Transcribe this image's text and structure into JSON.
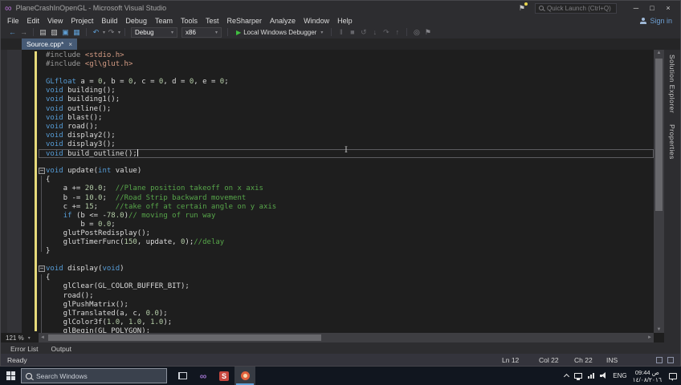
{
  "icons": {
    "dropdown": "▾",
    "play": "▶",
    "close": "×",
    "minimize": "─",
    "maximize": "□",
    "flag": "⚑",
    "infinity": "∞",
    "fold_minus": "−",
    "up": "▲",
    "down": "▼",
    "left": "◄",
    "right": "►"
  },
  "titlebar": {
    "title": "PlaneCrashInOpenGL - Microsoft Visual Studio",
    "quick_launch": "Quick Launch (Ctrl+Q)",
    "sign_in": "Sign in"
  },
  "menus": [
    "File",
    "Edit",
    "View",
    "Project",
    "Build",
    "Debug",
    "Team",
    "Tools",
    "Test",
    "ReSharper",
    "Analyze",
    "Window",
    "Help"
  ],
  "toolbar": {
    "items": [
      {
        "type": "icon",
        "name": "navigate-backward-icon",
        "glyph": "←",
        "color": "#5f9fd6"
      },
      {
        "type": "icon",
        "name": "navigate-forward-icon",
        "glyph": "→",
        "color": "#85858a"
      },
      {
        "type": "sep"
      },
      {
        "type": "icon",
        "name": "new-file-icon",
        "glyph": "▤",
        "color": "#c8c8c8"
      },
      {
        "type": "icon",
        "name": "open-file-icon",
        "glyph": "▨",
        "color": "#c8c8c8"
      },
      {
        "type": "icon",
        "name": "save-icon",
        "glyph": "▣",
        "color": "#5f9fd6"
      },
      {
        "type": "icon",
        "name": "save-all-icon",
        "glyph": "▦",
        "color": "#5f9fd6"
      },
      {
        "type": "sep"
      },
      {
        "type": "icon",
        "name": "undo-icon",
        "glyph": "↶",
        "color": "#5f9fd6",
        "dropdown": true
      },
      {
        "type": "icon",
        "name": "redo-icon",
        "glyph": "↷",
        "color": "#85858a",
        "dropdown": true
      },
      {
        "type": "sep"
      },
      {
        "type": "combo",
        "name": "solution-configurations-dropdown",
        "label": "Debug",
        "width": 58
      },
      {
        "type": "combo",
        "name": "solution-platforms-dropdown",
        "label": "x86",
        "width": 50
      },
      {
        "type": "sep"
      },
      {
        "type": "run",
        "name": "start-debugging-button",
        "label": "Local Windows Debugger"
      },
      {
        "type": "sep"
      },
      {
        "type": "icon",
        "name": "break-all-icon",
        "glyph": "‖",
        "color": "#66666b"
      },
      {
        "type": "icon",
        "name": "stop-debugging-icon",
        "glyph": "■",
        "color": "#66666b"
      },
      {
        "type": "icon",
        "name": "restart-icon",
        "glyph": "↺",
        "color": "#66666b"
      },
      {
        "type": "icon",
        "name": "step-into-icon",
        "glyph": "↓",
        "color": "#66666b"
      },
      {
        "type": "icon",
        "name": "step-over-icon",
        "glyph": "↷",
        "color": "#66666b"
      },
      {
        "type": "icon",
        "name": "step-out-icon",
        "glyph": "↑",
        "color": "#66666b"
      },
      {
        "type": "sep"
      },
      {
        "type": "icon",
        "name": "find-icon",
        "glyph": "◎",
        "color": "#85858a"
      },
      {
        "type": "icon",
        "name": "bookmark-icon",
        "glyph": "⚑",
        "color": "#85858a"
      }
    ]
  },
  "tabs": [
    {
      "label": "Source.cpp*"
    }
  ],
  "right_rail": [
    "Solution Explorer",
    "Properties"
  ],
  "editor": {
    "zoom_level": "121 %",
    "code_lines": [
      {
        "s": [
          [
            "pre",
            "#include "
          ],
          [
            "str",
            "<stdio.h>"
          ]
        ]
      },
      {
        "s": [
          [
            "pre",
            "#include "
          ],
          [
            "str",
            "<gl\\glut.h>"
          ]
        ]
      },
      {
        "s": []
      },
      {
        "s": [
          [
            "kw",
            "GLfloat"
          ],
          [
            "pl",
            " a = "
          ],
          [
            "num",
            "0"
          ],
          [
            "pl",
            ", b = "
          ],
          [
            "num",
            "0"
          ],
          [
            "pl",
            ", c = "
          ],
          [
            "num",
            "0"
          ],
          [
            "pl",
            ", d = "
          ],
          [
            "num",
            "0"
          ],
          [
            "pl",
            ", e = "
          ],
          [
            "num",
            "0"
          ],
          [
            "pl",
            ";"
          ]
        ]
      },
      {
        "s": [
          [
            "kw",
            "void"
          ],
          [
            "pl",
            " building();"
          ]
        ]
      },
      {
        "s": [
          [
            "kw",
            "void"
          ],
          [
            "pl",
            " building1();"
          ]
        ]
      },
      {
        "s": [
          [
            "kw",
            "void"
          ],
          [
            "pl",
            " outline();"
          ]
        ]
      },
      {
        "s": [
          [
            "kw",
            "void"
          ],
          [
            "pl",
            " blast();"
          ]
        ]
      },
      {
        "s": [
          [
            "kw",
            "void"
          ],
          [
            "pl",
            " road();"
          ]
        ]
      },
      {
        "s": [
          [
            "kw",
            "void"
          ],
          [
            "pl",
            " display2();"
          ]
        ]
      },
      {
        "s": [
          [
            "kw",
            "void"
          ],
          [
            "pl",
            " display3();"
          ]
        ]
      },
      {
        "c": true,
        "s": [
          [
            "kw",
            "void"
          ],
          [
            "pl",
            " build_outline();"
          ]
        ]
      },
      {
        "s": []
      },
      {
        "f": true,
        "s": [
          [
            "kw",
            "void"
          ],
          [
            "pl",
            " update("
          ],
          [
            "kw",
            "int"
          ],
          [
            "pl",
            " value)"
          ]
        ]
      },
      {
        "s": [
          [
            "pl",
            "{"
          ]
        ]
      },
      {
        "s": [
          [
            "pl",
            "    a += "
          ],
          [
            "num",
            "20.0"
          ],
          [
            "pl",
            ";  "
          ],
          [
            "com",
            "//Plane position takeoff on x axis"
          ]
        ]
      },
      {
        "s": [
          [
            "pl",
            "    b -= "
          ],
          [
            "num",
            "10.0"
          ],
          [
            "pl",
            ";  "
          ],
          [
            "com",
            "//Road Strip backward movement"
          ]
        ]
      },
      {
        "s": [
          [
            "pl",
            "    c += "
          ],
          [
            "num",
            "15"
          ],
          [
            "pl",
            ";    "
          ],
          [
            "com",
            "//take off at certain angle on y axis"
          ]
        ]
      },
      {
        "s": [
          [
            "pl",
            "    "
          ],
          [
            "kw",
            "if"
          ],
          [
            "pl",
            " (b <= -"
          ],
          [
            "num",
            "78.0"
          ],
          [
            "pl",
            ")"
          ],
          [
            "com",
            "// moving of run way"
          ]
        ]
      },
      {
        "s": [
          [
            "pl",
            "        b = "
          ],
          [
            "num",
            "0.0"
          ],
          [
            "pl",
            ";"
          ]
        ]
      },
      {
        "s": [
          [
            "pl",
            "    glutPostRedisplay();"
          ]
        ]
      },
      {
        "s": [
          [
            "pl",
            "    glutTimerFunc("
          ],
          [
            "num",
            "150"
          ],
          [
            "pl",
            ", update, "
          ],
          [
            "num",
            "0"
          ],
          [
            "pl",
            ");"
          ],
          [
            "com",
            "//delay"
          ]
        ]
      },
      {
        "s": [
          [
            "pl",
            "}"
          ]
        ]
      },
      {
        "s": []
      },
      {
        "f": true,
        "s": [
          [
            "kw",
            "void"
          ],
          [
            "pl",
            " display("
          ],
          [
            "kw",
            "void"
          ],
          [
            "pl",
            ")"
          ]
        ]
      },
      {
        "s": [
          [
            "pl",
            "{"
          ]
        ]
      },
      {
        "s": [
          [
            "pl",
            "    glClear(GL_COLOR_BUFFER_BIT);"
          ]
        ]
      },
      {
        "s": [
          [
            "pl",
            "    road();"
          ]
        ]
      },
      {
        "s": [
          [
            "pl",
            "    glPushMatrix();"
          ]
        ]
      },
      {
        "s": [
          [
            "pl",
            "    glTranslated(a, c, "
          ],
          [
            "num",
            "0.0"
          ],
          [
            "pl",
            ");"
          ]
        ]
      },
      {
        "s": [
          [
            "pl",
            "    glColor3f("
          ],
          [
            "num",
            "1.0"
          ],
          [
            "pl",
            ", "
          ],
          [
            "num",
            "1.0"
          ],
          [
            "pl",
            ", "
          ],
          [
            "num",
            "1.0"
          ],
          [
            "pl",
            ");"
          ]
        ]
      },
      {
        "s": [
          [
            "pl",
            "    glBegin(GL_POLYGON);"
          ]
        ]
      }
    ]
  },
  "panel_tabs": [
    "Error List",
    "Output"
  ],
  "statusbar": {
    "ready": "Ready",
    "line": "Ln 12",
    "column": "Col 22",
    "character": "Ch 22",
    "mode": "INS"
  },
  "taskbar": {
    "search_placeholder": "Search Windows",
    "apps": [
      {
        "kind": "taskview",
        "name": "task-view-button"
      },
      {
        "kind": "vs",
        "name": "visual-studio-taskbar-icon"
      },
      {
        "kind": "s",
        "name": "s-app-taskbar-icon",
        "label": "S"
      },
      {
        "kind": "active",
        "name": "active-app-taskbar-icon"
      }
    ],
    "tray": {
      "lang": "ENG",
      "time": "09:44 ص",
      "date": "١٤/٠٨/٢٠١٦"
    }
  },
  "colors": {
    "editor_bg": "#1e1e1e",
    "chrome_bg": "#2d2d30",
    "active_tab": "#465a75",
    "keyword": "#569cd6",
    "number": "#b5cea8",
    "comment": "#57a64a",
    "string": "#d69d85",
    "preprocessor": "#9b9b9b",
    "change_bar": "#e6d97a",
    "run_green": "#40c040"
  }
}
